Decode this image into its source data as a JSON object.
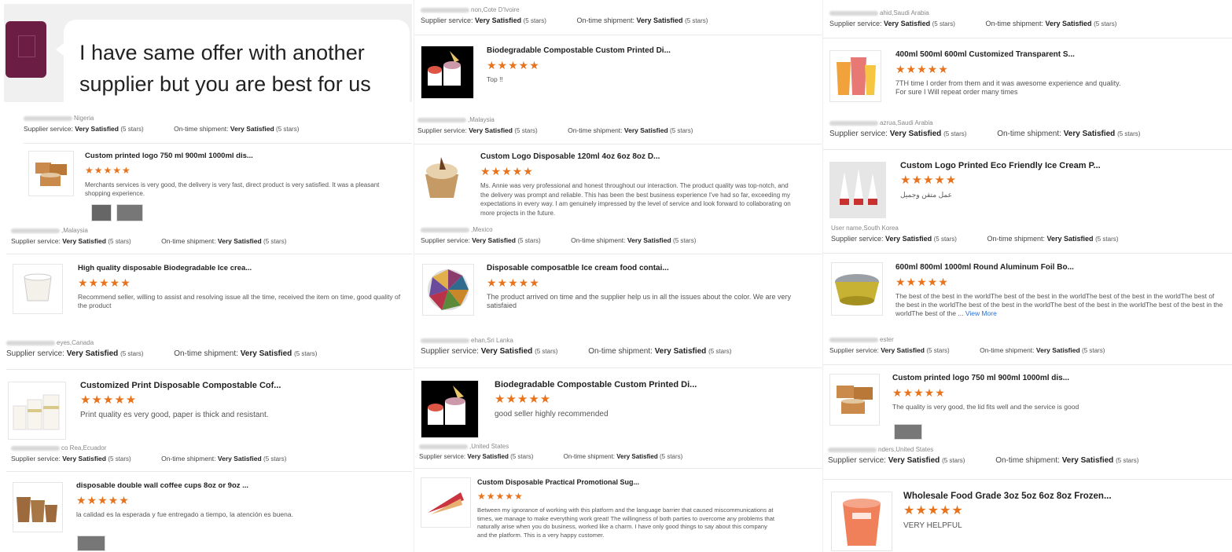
{
  "colors": {
    "star": "#e8731c",
    "link": "#2a6fd6",
    "avatar": "#6b1d44"
  },
  "chat": {
    "line1": "I have same offer with another",
    "line2": "supplier but you are best for us"
  },
  "labels": {
    "supplier": "Supplier service:",
    "shipment": "On-time shipment:",
    "rating": "Very Satisfied",
    "stars_count": "(5 stars)",
    "stars_glyph": "★★★★★"
  },
  "col1": [
    {
      "user": "Nigeria",
      "title": "Custom printed logo 750 ml 900ml 1000ml dis...",
      "comment": "Merchants services is very good, the delivery     is very fast, direct product is very satisfied. It was a pleasant shopping experience.",
      "thumb": "kraft-bowl-icon"
    },
    {
      "user": ",Malaysia",
      "title": "High quality disposable Biodegradable Ice crea...",
      "comment": "Recommend seller, willing to assist and resolving issue all the time, received the item on time, good quality of the product",
      "thumb": "white-cup-icon"
    },
    {
      "user": "eyes,Canada",
      "title": "Customized Print Disposable Compostable Cof...",
      "comment": "Print quality es very good, paper is thick and resistant.",
      "thumb": "coffee-cups-icon"
    },
    {
      "user": "co Rea,Ecuador",
      "title": "disposable double wall coffee cups 8oz or 9oz ...",
      "comment": "la calidad es la esperada y fue entregado a tiempo, la atención es buena.",
      "thumb": "double-wall-cups-icon"
    }
  ],
  "col2": [
    {
      "user": "non,Cote D'Ivoire",
      "title": "Biodegradable Compostable Custom Printed Di...",
      "comment": "Top !!",
      "thumb": "ice-cream-cups-icon"
    },
    {
      "user": ",Malaysia",
      "title": "Custom Logo Disposable 120ml 4oz 6oz 8oz D...",
      "comment": "Ms. Annie was very professional and honest throughout our interaction. The product quality was top-notch, and the delivery was prompt and reliable. This has been the best business experience I've had so far, exceeding my expectations in every way. I am genuinely impressed by the level of service and look forward to collaborating on more projects in the future.",
      "thumb": "ice-cream-bowl-icon"
    },
    {
      "user": ",Mexico",
      "title": "Disposable composatble Ice cream food contai...",
      "comment": "The product arrived on time and the supplier help us in all the issues about the color. We are very satisfaied",
      "thumb": "color-fan-icon"
    },
    {
      "user": "ehan,Sri Lanka",
      "title": "Biodegradable Compostable Custom Printed Di...",
      "comment": "good seller highly recommended",
      "thumb": "ice-cream-cups-icon"
    },
    {
      "user": ",United States",
      "title": "Custom Disposable Practical Promotional Sug...",
      "comment": "Between my ignorance of working with this platform and the language barrier that caused miscommunications at times, we manage to make everything work great! The willingness of both parties to overcome any problems that naturally arise when you do business, worked like a charm. I have only good things to say about this company and the platform. This is a very happy customer.",
      "thumb": "cone-sleeve-icon"
    }
  ],
  "col3": [
    {
      "user": "ahid,Saudi Arabia",
      "title": "400ml 500ml 600ml Customized Transparent S...",
      "comment": "7TH time I order from them and it was awesome experience and quality. For sure I Will repeat order many times",
      "thumb": "transparent-cups-icon"
    },
    {
      "user": "azrua,Saudi Arabia",
      "title": "Custom Logo Printed Eco Friendly Ice Cream P...",
      "comment": "عمل متقن وجميل",
      "thumb": "ice-cream-cones-icon"
    },
    {
      "user": "User name,South Korea",
      "title": "600ml 800ml 1000ml Round Aluminum Foil Bo...",
      "comment": "The best of the best in the worldThe best of the best in the worldThe best of the best in the worldThe best of the best in the worldThe best of the best in the worldThe best of the best in the worldThe best of the best in the worldThe best of the ...",
      "more": "View More",
      "thumb": "foil-bowl-icon"
    },
    {
      "user": "ester",
      "title": "Custom printed logo 750 ml 900ml 1000ml dis...",
      "comment": "The quality is very good, the lid fits well and the service is good",
      "thumb": "kraft-bowl-icon"
    },
    {
      "user": "nders,United States",
      "title": "Wholesale Food Grade 3oz 5oz 6oz 8oz Frozen...",
      "comment": "VERY HELPFUL",
      "thumb": "frozen-cup-icon"
    }
  ]
}
